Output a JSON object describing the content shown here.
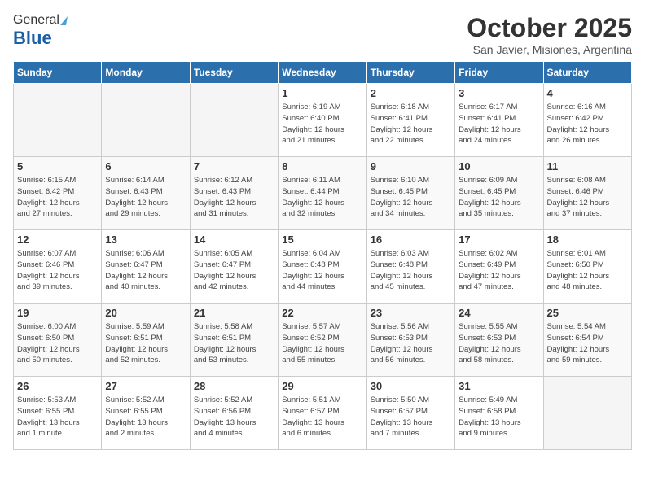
{
  "header": {
    "logo_line1": "General",
    "logo_line2": "Blue",
    "month": "October 2025",
    "location": "San Javier, Misiones, Argentina"
  },
  "weekdays": [
    "Sunday",
    "Monday",
    "Tuesday",
    "Wednesday",
    "Thursday",
    "Friday",
    "Saturday"
  ],
  "weeks": [
    [
      {
        "day": "",
        "info": ""
      },
      {
        "day": "",
        "info": ""
      },
      {
        "day": "",
        "info": ""
      },
      {
        "day": "1",
        "info": "Sunrise: 6:19 AM\nSunset: 6:40 PM\nDaylight: 12 hours\nand 21 minutes."
      },
      {
        "day": "2",
        "info": "Sunrise: 6:18 AM\nSunset: 6:41 PM\nDaylight: 12 hours\nand 22 minutes."
      },
      {
        "day": "3",
        "info": "Sunrise: 6:17 AM\nSunset: 6:41 PM\nDaylight: 12 hours\nand 24 minutes."
      },
      {
        "day": "4",
        "info": "Sunrise: 6:16 AM\nSunset: 6:42 PM\nDaylight: 12 hours\nand 26 minutes."
      }
    ],
    [
      {
        "day": "5",
        "info": "Sunrise: 6:15 AM\nSunset: 6:42 PM\nDaylight: 12 hours\nand 27 minutes."
      },
      {
        "day": "6",
        "info": "Sunrise: 6:14 AM\nSunset: 6:43 PM\nDaylight: 12 hours\nand 29 minutes."
      },
      {
        "day": "7",
        "info": "Sunrise: 6:12 AM\nSunset: 6:43 PM\nDaylight: 12 hours\nand 31 minutes."
      },
      {
        "day": "8",
        "info": "Sunrise: 6:11 AM\nSunset: 6:44 PM\nDaylight: 12 hours\nand 32 minutes."
      },
      {
        "day": "9",
        "info": "Sunrise: 6:10 AM\nSunset: 6:45 PM\nDaylight: 12 hours\nand 34 minutes."
      },
      {
        "day": "10",
        "info": "Sunrise: 6:09 AM\nSunset: 6:45 PM\nDaylight: 12 hours\nand 35 minutes."
      },
      {
        "day": "11",
        "info": "Sunrise: 6:08 AM\nSunset: 6:46 PM\nDaylight: 12 hours\nand 37 minutes."
      }
    ],
    [
      {
        "day": "12",
        "info": "Sunrise: 6:07 AM\nSunset: 6:46 PM\nDaylight: 12 hours\nand 39 minutes."
      },
      {
        "day": "13",
        "info": "Sunrise: 6:06 AM\nSunset: 6:47 PM\nDaylight: 12 hours\nand 40 minutes."
      },
      {
        "day": "14",
        "info": "Sunrise: 6:05 AM\nSunset: 6:47 PM\nDaylight: 12 hours\nand 42 minutes."
      },
      {
        "day": "15",
        "info": "Sunrise: 6:04 AM\nSunset: 6:48 PM\nDaylight: 12 hours\nand 44 minutes."
      },
      {
        "day": "16",
        "info": "Sunrise: 6:03 AM\nSunset: 6:48 PM\nDaylight: 12 hours\nand 45 minutes."
      },
      {
        "day": "17",
        "info": "Sunrise: 6:02 AM\nSunset: 6:49 PM\nDaylight: 12 hours\nand 47 minutes."
      },
      {
        "day": "18",
        "info": "Sunrise: 6:01 AM\nSunset: 6:50 PM\nDaylight: 12 hours\nand 48 minutes."
      }
    ],
    [
      {
        "day": "19",
        "info": "Sunrise: 6:00 AM\nSunset: 6:50 PM\nDaylight: 12 hours\nand 50 minutes."
      },
      {
        "day": "20",
        "info": "Sunrise: 5:59 AM\nSunset: 6:51 PM\nDaylight: 12 hours\nand 52 minutes."
      },
      {
        "day": "21",
        "info": "Sunrise: 5:58 AM\nSunset: 6:51 PM\nDaylight: 12 hours\nand 53 minutes."
      },
      {
        "day": "22",
        "info": "Sunrise: 5:57 AM\nSunset: 6:52 PM\nDaylight: 12 hours\nand 55 minutes."
      },
      {
        "day": "23",
        "info": "Sunrise: 5:56 AM\nSunset: 6:53 PM\nDaylight: 12 hours\nand 56 minutes."
      },
      {
        "day": "24",
        "info": "Sunrise: 5:55 AM\nSunset: 6:53 PM\nDaylight: 12 hours\nand 58 minutes."
      },
      {
        "day": "25",
        "info": "Sunrise: 5:54 AM\nSunset: 6:54 PM\nDaylight: 12 hours\nand 59 minutes."
      }
    ],
    [
      {
        "day": "26",
        "info": "Sunrise: 5:53 AM\nSunset: 6:55 PM\nDaylight: 13 hours\nand 1 minute."
      },
      {
        "day": "27",
        "info": "Sunrise: 5:52 AM\nSunset: 6:55 PM\nDaylight: 13 hours\nand 2 minutes."
      },
      {
        "day": "28",
        "info": "Sunrise: 5:52 AM\nSunset: 6:56 PM\nDaylight: 13 hours\nand 4 minutes."
      },
      {
        "day": "29",
        "info": "Sunrise: 5:51 AM\nSunset: 6:57 PM\nDaylight: 13 hours\nand 6 minutes."
      },
      {
        "day": "30",
        "info": "Sunrise: 5:50 AM\nSunset: 6:57 PM\nDaylight: 13 hours\nand 7 minutes."
      },
      {
        "day": "31",
        "info": "Sunrise: 5:49 AM\nSunset: 6:58 PM\nDaylight: 13 hours\nand 9 minutes."
      },
      {
        "day": "",
        "info": ""
      }
    ]
  ]
}
